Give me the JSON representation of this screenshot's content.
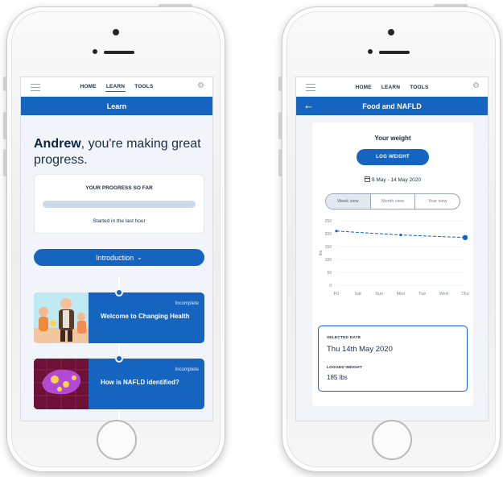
{
  "nav": {
    "home": "HOME",
    "learn": "LEARN",
    "tools": "TOOLS"
  },
  "learn_screen": {
    "title": "Learn",
    "greeting_name": "Andrew",
    "greeting_rest": ", you're making great progress.",
    "progress": {
      "title": "YOUR PROGRESS SO FAR",
      "caption": "Started in the last hour",
      "fraction": 0.0
    },
    "section_button": "Introduction",
    "lessons": [
      {
        "status": "Incomplete",
        "title": "Welcome to Changing Health"
      },
      {
        "status": "Incomplete",
        "title": "How is NAFLD identified?"
      }
    ]
  },
  "food_screen": {
    "title": "Food and NAFLD",
    "card_title": "Your weight",
    "log_button": "LOG WEIGHT",
    "date_range": "8 May - 14 May 2020",
    "views": [
      "Week view",
      "Month view",
      "Year view"
    ],
    "active_view": "Week view",
    "selected_date_label": "SELECTED DATE",
    "selected_date": "Thu 14th May 2020",
    "logged_weight_label": "LOGGED WEIGHT",
    "logged_weight": "185 lbs"
  },
  "chart_data": {
    "type": "line",
    "ylabel": "lbs",
    "ylim": [
      0,
      250
    ],
    "yticks": [
      0,
      50,
      100,
      150,
      200,
      250
    ],
    "categories": [
      "Fri",
      "Sat",
      "Sun",
      "Mon",
      "Tue",
      "Wed",
      "Thu"
    ],
    "series": [
      {
        "points": [
          {
            "x": "Fri",
            "y": 210
          },
          {
            "x": "Mon",
            "y": 195
          },
          {
            "x": "Thu",
            "y": 185
          }
        ]
      }
    ],
    "grid": true,
    "color": "#1565c0"
  },
  "colors": {
    "primary": "#1565c0",
    "background": "#f1f4f8",
    "text": "#1d2d44"
  }
}
